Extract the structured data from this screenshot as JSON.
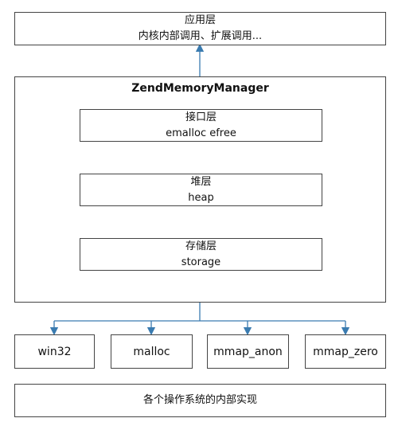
{
  "diagram": {
    "app_layer": {
      "title": "应用层",
      "subtitle": "内核内部调用、扩展调用..."
    },
    "manager": {
      "title": "ZendMemoryManager",
      "layers": [
        {
          "title": "接口层",
          "subtitle": "emalloc efree"
        },
        {
          "title": "堆层",
          "subtitle": "heap"
        },
        {
          "title": "存储层",
          "subtitle": "storage"
        }
      ]
    },
    "backends": [
      "win32",
      "malloc",
      "mmap_anon",
      "mmap_zero"
    ],
    "os_layer": {
      "title": "各个操作系统的内部实现"
    },
    "connector_color": "#3a7bb0"
  }
}
